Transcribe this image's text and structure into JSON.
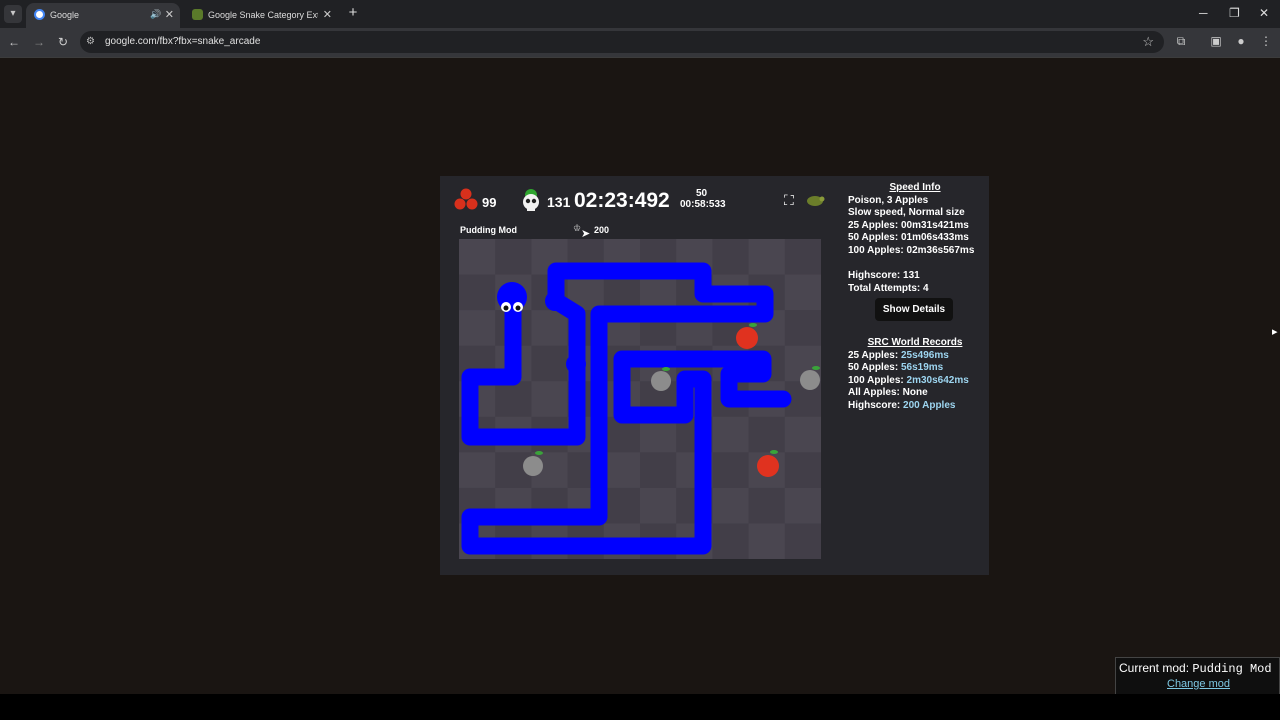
{
  "browser": {
    "tabs": [
      {
        "title": "Google",
        "active": true,
        "audio": true
      },
      {
        "title": "Google Snake Category Extensi",
        "active": false,
        "audio": false
      }
    ],
    "url": "google.com/fbx?fbx=snake_arcade"
  },
  "game": {
    "apples_count": "99",
    "score": "131",
    "timer": "02:23:492",
    "goal_count": "50",
    "goal_time": "00:58:533",
    "mod_label": "Pudding Mod",
    "target": "200"
  },
  "info": {
    "speed_header": "Speed Info",
    "lines": [
      "Poison, 3 Apples",
      "Slow speed, Normal size",
      "25 Apples: 00m31s421ms",
      "50 Apples: 01m06s433ms",
      "100 Apples: 02m36s567ms"
    ],
    "highscore": "Highscore: 131",
    "attempts": "Total Attempts: 4",
    "show_details": "Show Details",
    "records_header": "SRC World Records",
    "records": [
      {
        "label": "25 Apples: ",
        "value": "25s496ms"
      },
      {
        "label": "50 Apples: ",
        "value": "56s19ms"
      },
      {
        "label": "100 Apples: ",
        "value": "2m30s642ms"
      },
      {
        "label": "All Apples: ",
        "value": "None"
      },
      {
        "label": "Highscore: ",
        "value": "200 Apples"
      }
    ]
  },
  "mod_box": {
    "current_label": "Current mod: ",
    "current_value": "Pudding Mod",
    "change_link": "Change mod"
  },
  "colors": {
    "snake": "#0000ff",
    "apple_red": "#e0321f",
    "apple_poison": "#8c8c8c",
    "board_light": "#4a4650",
    "board_dark": "#423e48"
  }
}
